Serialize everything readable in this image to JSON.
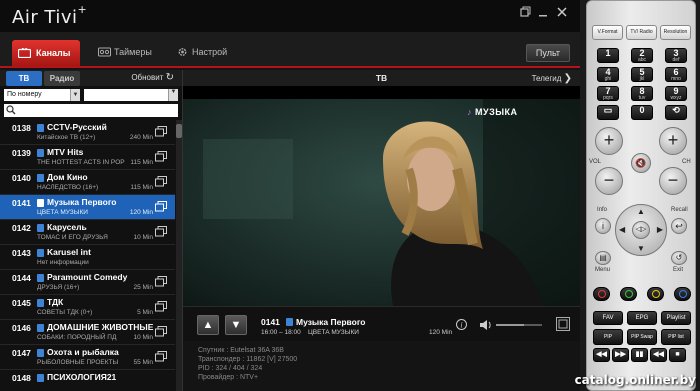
{
  "app": {
    "title": "Air Tivi",
    "title_sup": "+"
  },
  "tabs": [
    {
      "label": "Каналы",
      "icon": "tv-icon",
      "active": true
    },
    {
      "label": "Таймеры",
      "icon": "tape-icon",
      "active": false
    },
    {
      "label": "Настрой",
      "icon": "gear-icon",
      "active": false
    }
  ],
  "portal_label": "Пульт",
  "left_panel": {
    "tv_label": "ТВ",
    "radio_label": "Радио",
    "refresh_label": "Обновит",
    "sort_value": "По номеру"
  },
  "channels": [
    {
      "num": "0138",
      "name": "CCTV-Русский",
      "time": "",
      "prog": "Китайское ТВ (12+)",
      "dur": "240 Min",
      "selected": false
    },
    {
      "num": "0139",
      "name": "MTV Hits",
      "time": "",
      "prog": "THE HOTTEST ACTS IN POP",
      "dur": "115 Min",
      "selected": false
    },
    {
      "num": "0140",
      "name": "Дом Кино",
      "time": "",
      "prog": "НАСЛЕДСТВО (16+)",
      "dur": "115 Min",
      "selected": false
    },
    {
      "num": "0141",
      "name": "Музыка Первого",
      "time": "",
      "prog": "ЦВЕТА МУЗЫКИ",
      "dur": "120 Min",
      "selected": true
    },
    {
      "num": "0142",
      "name": "Карусель",
      "time": "",
      "prog": "ТОМАС И ЕГО ДРУЗЬЯ",
      "dur": "10 Min",
      "selected": false
    },
    {
      "num": "0143",
      "name": "Karusel int",
      "time": "",
      "prog": "Нет информации",
      "dur": "",
      "selected": false
    },
    {
      "num": "0144",
      "name": "Paramount Comedy",
      "time": "",
      "prog": "ДРУЗЬЯ (16+)",
      "dur": "25 Min",
      "selected": false
    },
    {
      "num": "0145",
      "name": "ТДК",
      "time": "",
      "prog": "СОВЕТЫ ТДК (0+)",
      "dur": "5 Min",
      "selected": false
    },
    {
      "num": "0146",
      "name": "ДОМАШНИЕ ЖИВОТНЫЕ",
      "time": "",
      "prog": "СОБАКИ: ПОРОДНЫЙ ПД",
      "dur": "10 Min",
      "selected": false
    },
    {
      "num": "0147",
      "name": "Охота и рыбалка",
      "time": "",
      "prog": "РЫБОЛОВНЫЕ ПРОЕКТЫ",
      "dur": "55 Min",
      "selected": false
    },
    {
      "num": "0148",
      "name": "ПСИХОЛОГИЯ21",
      "time": "",
      "prog": "",
      "dur": "",
      "selected": false
    }
  ],
  "center": {
    "tv_label": "ТВ",
    "guide_label": "Телегид",
    "video_channel_logo_text": "МУЗЫКА"
  },
  "now_playing": {
    "num": "0141",
    "name": "Музыка Первого",
    "time": "16:00 – 18:00",
    "prog": "ЦВЕТА МУЗЫКИ",
    "dur": "120 Min",
    "volume_fraction": 0.6
  },
  "sat_info": [
    "Спутник : Eutelsat 36A 36B",
    "Транспондер : 11862 [V] 27500",
    "PID : 324 / 404 / 324",
    "Провайдер : NTV+"
  ],
  "remote": {
    "formats": [
      "V.Format",
      "TV/ Radio",
      "Resolution"
    ],
    "numbers": [
      {
        "n": "1",
        "s": ""
      },
      {
        "n": "2",
        "s": "abc"
      },
      {
        "n": "3",
        "s": "def"
      },
      {
        "n": "4",
        "s": "ghi"
      },
      {
        "n": "5",
        "s": "jkl"
      },
      {
        "n": "6",
        "s": "mno"
      },
      {
        "n": "7",
        "s": "pqrs"
      },
      {
        "n": "8",
        "s": "tuv"
      },
      {
        "n": "9",
        "s": "wxyz"
      },
      {
        "n": "",
        "s": ""
      },
      {
        "n": "0",
        "s": ""
      },
      {
        "n": "",
        "s": ""
      }
    ],
    "vol_label": "VOL",
    "ch_label": "CH",
    "info_label": "Info",
    "recall_label": "Recall",
    "menu_label": "Menu",
    "exit_label": "Exit",
    "colors": [
      "#e23a3a",
      "#3cc43c",
      "#e8c41a",
      "#3a7fe8"
    ],
    "fav_label": "FAV",
    "epg_label": "EPG",
    "playlist_label": "Playlist",
    "pip_labels": [
      "PIP",
      "PIP Swap",
      "PIP list"
    ],
    "transport": [
      "◀◀",
      "▶▶",
      "▮▮",
      "◀◀",
      "■",
      "▶▶"
    ]
  },
  "watermark": "catalog.onliner.by"
}
